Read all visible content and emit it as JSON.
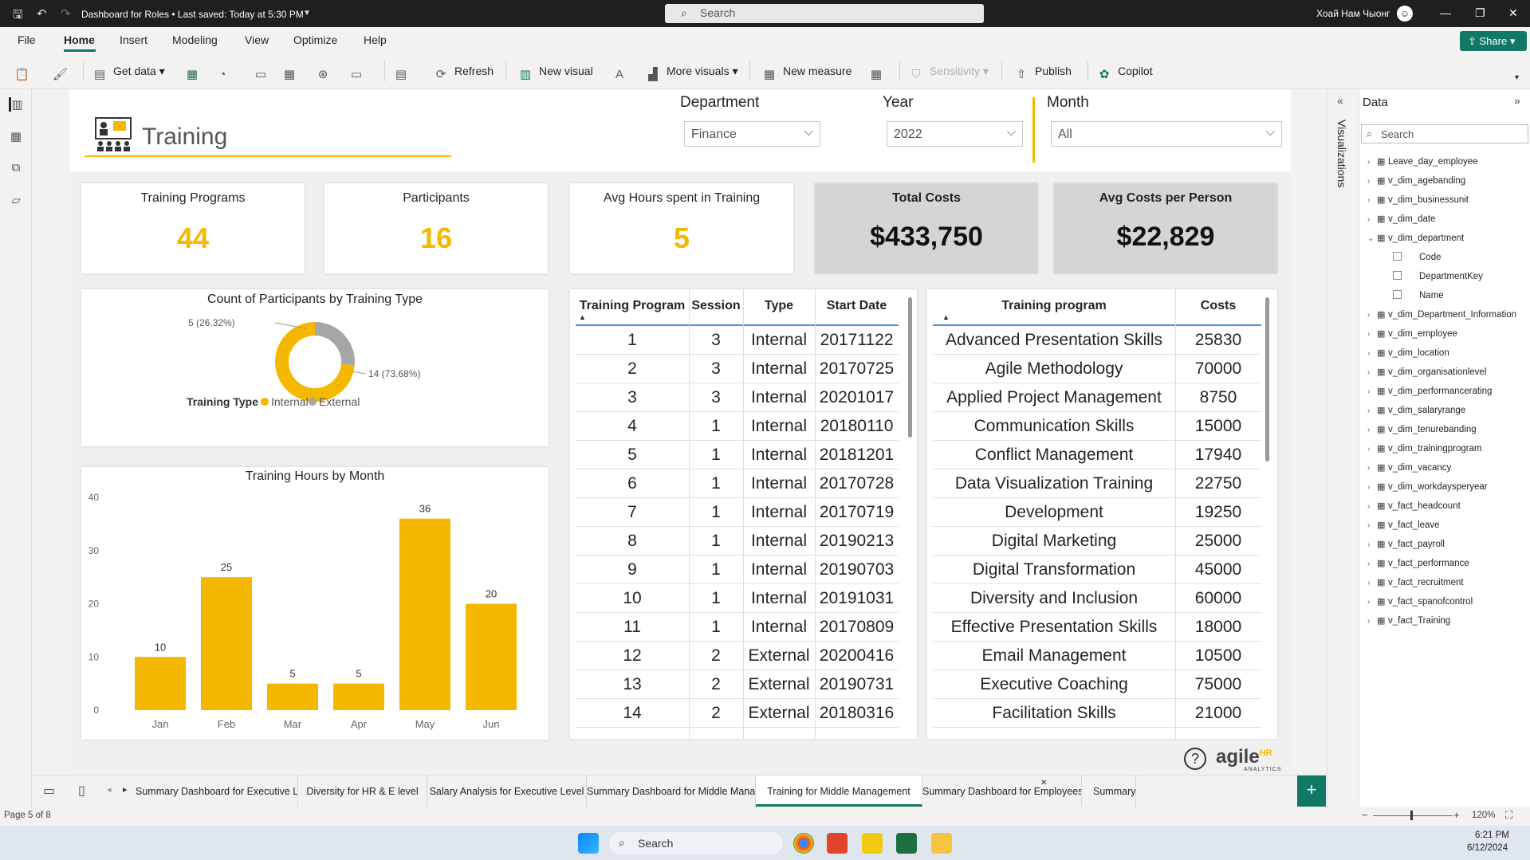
{
  "window": {
    "title": "Dashboard for Roles • Last saved: Today at 5:30 PM",
    "search_placeholder": "Search",
    "user": "Хоай Нам Чыонг"
  },
  "menu": {
    "items": [
      "File",
      "Home",
      "Insert",
      "Modeling",
      "View",
      "Optimize",
      "Help"
    ],
    "share": "Share"
  },
  "ribbon": {
    "get_data": "Get data",
    "refresh": "Refresh",
    "new_visual": "New visual",
    "more_visuals": "More visuals",
    "new_measure": "New measure",
    "sensitivity": "Sensitivity",
    "publish": "Publish",
    "copilot": "Copilot"
  },
  "report": {
    "title": "Training",
    "slicers": {
      "department": {
        "label": "Department",
        "value": "Finance"
      },
      "year": {
        "label": "Year",
        "value": "2022"
      },
      "month": {
        "label": "Month",
        "value": "All"
      }
    },
    "kpis": [
      {
        "label": "Training Programs",
        "value": "44"
      },
      {
        "label": "Participants",
        "value": "16"
      },
      {
        "label": "Avg Hours spent in Training",
        "value": "5"
      },
      {
        "label": "Total Costs",
        "value": "$433,750"
      },
      {
        "label": "Avg Costs per Person",
        "value": "$22,829"
      }
    ],
    "table1": {
      "headers": [
        "Training Program",
        "Session",
        "Type",
        "Start Date"
      ],
      "rows": [
        [
          "1",
          "3",
          "Internal",
          "20171122"
        ],
        [
          "2",
          "3",
          "Internal",
          "20170725"
        ],
        [
          "3",
          "3",
          "Internal",
          "20201017"
        ],
        [
          "4",
          "1",
          "Internal",
          "20180110"
        ],
        [
          "5",
          "1",
          "Internal",
          "20181201"
        ],
        [
          "6",
          "1",
          "Internal",
          "20170728"
        ],
        [
          "7",
          "1",
          "Internal",
          "20170719"
        ],
        [
          "8",
          "1",
          "Internal",
          "20190213"
        ],
        [
          "9",
          "1",
          "Internal",
          "20190703"
        ],
        [
          "10",
          "1",
          "Internal",
          "20191031"
        ],
        [
          "11",
          "1",
          "Internal",
          "20170809"
        ],
        [
          "12",
          "2",
          "External",
          "20200416"
        ],
        [
          "13",
          "2",
          "External",
          "20190731"
        ],
        [
          "14",
          "2",
          "External",
          "20180316"
        ]
      ]
    },
    "table2": {
      "headers": [
        "Training program",
        "Costs"
      ],
      "rows": [
        [
          "Advanced Presentation Skills",
          "25830"
        ],
        [
          "Agile Methodology",
          "70000"
        ],
        [
          "Applied Project Management",
          "8750"
        ],
        [
          "Communication Skills",
          "15000"
        ],
        [
          "Conflict Management",
          "17940"
        ],
        [
          "Data Visualization Training",
          "22750"
        ],
        [
          "Development",
          "19250"
        ],
        [
          "Digital Marketing",
          "25000"
        ],
        [
          "Digital Transformation",
          "45000"
        ],
        [
          "Diversity and Inclusion",
          "60000"
        ],
        [
          "Effective Presentation Skills",
          "18000"
        ],
        [
          "Email Management",
          "10500"
        ],
        [
          "Executive Coaching",
          "75000"
        ],
        [
          "Facilitation Skills",
          "21000"
        ]
      ]
    },
    "brand": "agile",
    "brand_sub": "ANALYTICS",
    "brand_hr": "HR"
  },
  "chart_data": [
    {
      "type": "pie",
      "title": "Count of Participants by Training Type",
      "legend_title": "Training Type",
      "categories": [
        "Internal",
        "External"
      ],
      "values": [
        14,
        5
      ],
      "labels": [
        "14 (73.68%)",
        "5 (26.32%)"
      ],
      "colors": [
        "#f5b800",
        "#a6a6a6"
      ]
    },
    {
      "type": "bar",
      "title": "Training Hours by Month",
      "categories": [
        "Jan",
        "Feb",
        "Mar",
        "Apr",
        "May",
        "Jun"
      ],
      "values": [
        10,
        25,
        5,
        5,
        36,
        20
      ],
      "ylim": [
        0,
        40
      ],
      "yticks": [
        "0",
        "10",
        "20",
        "30",
        "40"
      ],
      "color": "#f5b800"
    }
  ],
  "panes": {
    "visualizations": "Visualizations",
    "data_title": "Data",
    "data_search": "Search",
    "fields": [
      "Leave_day_employee",
      "v_dim_agebanding",
      "v_dim_businessunit",
      "v_dim_date",
      "v_dim_department"
    ],
    "department_fields": [
      "Code",
      "DepartmentKey",
      "Name"
    ],
    "fields_after": [
      "v_dim_Department_Information",
      "v_dim_employee",
      "v_dim_location",
      "v_dim_organisationlevel",
      "v_dim_performancerating",
      "v_dim_salaryrange",
      "v_dim_tenurebanding",
      "v_dim_trainingprogram",
      "v_dim_vacancy",
      "v_dim_workdaysperyear",
      "v_fact_headcount",
      "v_fact_leave",
      "v_fact_payroll",
      "v_fact_performance",
      "v_fact_recruitment",
      "v_fact_spanofcontrol",
      "v_fact_Training"
    ]
  },
  "page_tabs": [
    "Summary Dashboard for Executive Level",
    "Diversity for HR & E level",
    "Salary Analysis for Executive Level",
    "Summary Dashboard for Middle Managem...",
    "Training for Middle Management",
    "Summary Dashboard for Employees",
    "Summary D"
  ],
  "status": {
    "page": "Page 5 of 8",
    "zoom": "120%"
  },
  "taskbar": {
    "search": "Search",
    "time": "6:21 PM",
    "date": "6/12/2024"
  }
}
